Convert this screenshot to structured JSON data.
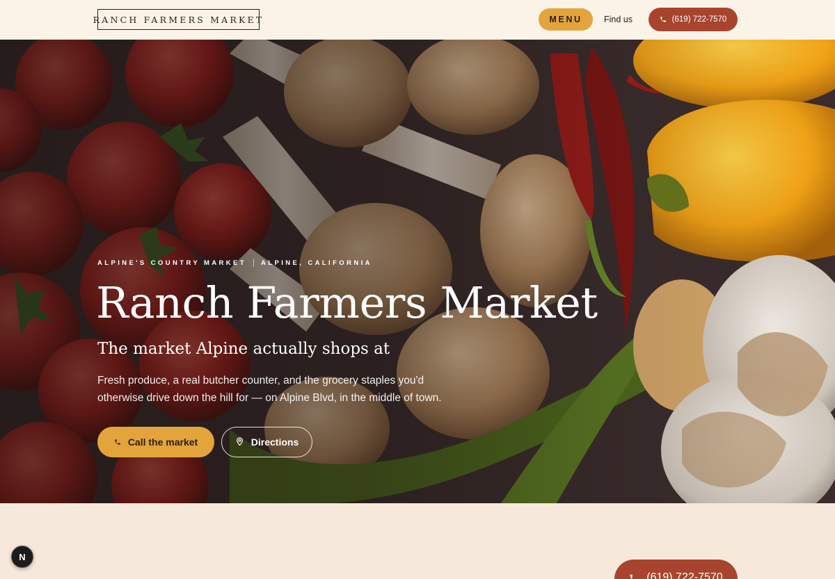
{
  "header": {
    "logo": "RANCH FARMERS MARKET",
    "menu_label": "MENU",
    "find_us_label": "Find us",
    "phone_label": "(619) 722-7570"
  },
  "hero": {
    "eyebrow_left": "ALPINE'S COUNTRY MARKET",
    "eyebrow_right": "ALPINE, CALIFORNIA",
    "title": "Ranch Farmers Market",
    "subtitle": "The market Alpine actually shops at",
    "body": "Fresh produce, a real butcher counter, and the grocery staples you'd otherwise drive down the hill for — on Alpine Blvd, in the middle of town.",
    "primary_cta": "Call the market",
    "secondary_cta": "Directions"
  },
  "floating": {
    "badge": "N",
    "phone_label": "(619) 722-7570"
  },
  "colors": {
    "accent": "#e3a53b",
    "brand": "#a8442d",
    "header_bg": "#fcf3e8",
    "page_bg": "#f6e8da"
  },
  "icons": {
    "phone": "phone-icon",
    "location": "map-pin-icon"
  }
}
